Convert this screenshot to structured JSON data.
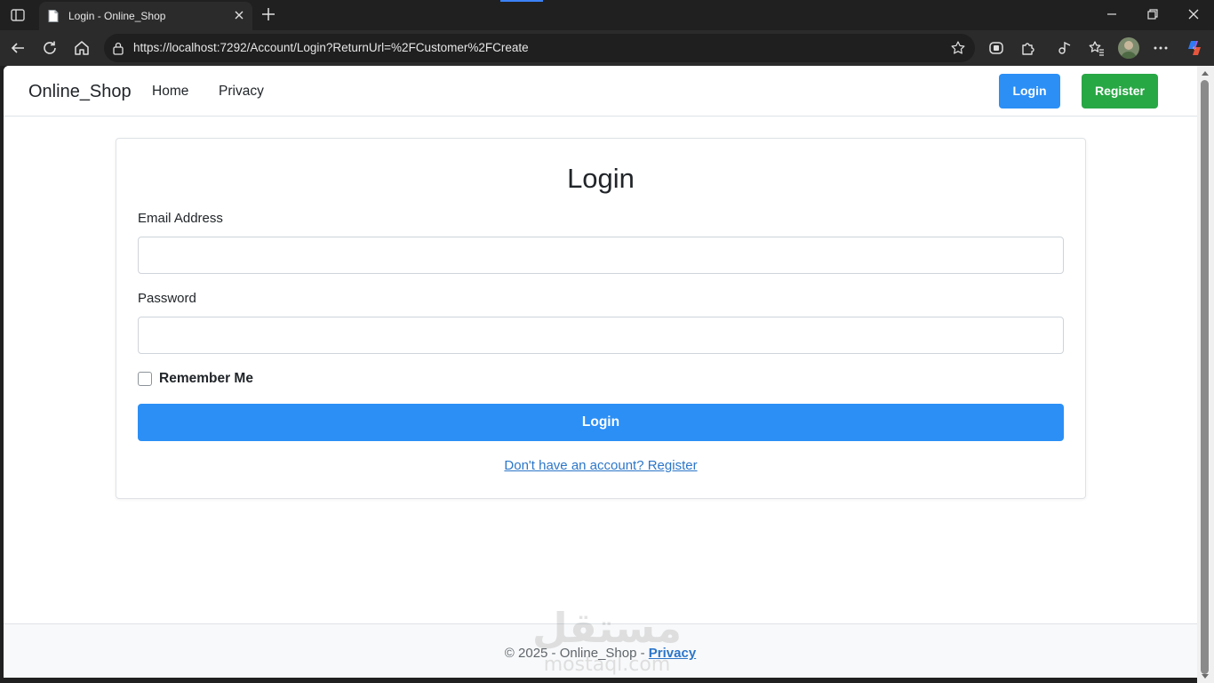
{
  "browser": {
    "tab_title": "Login - Online_Shop",
    "url": "https://localhost:7292/Account/Login?ReturnUrl=%2FCustomer%2FCreate",
    "accent_color": "#3b82f6",
    "icons": [
      "sidebar-toggle-icon",
      "page-favicon-icon",
      "close-tab-icon",
      "new-tab-icon",
      "minimize-icon",
      "maximize-icon",
      "close-window-icon",
      "back-icon",
      "reload-icon",
      "home-icon",
      "lock-icon",
      "favorite-star-icon",
      "extension-icon",
      "puzzle-icon",
      "split-screen-icon",
      "favorites-icon",
      "profile-avatar",
      "more-icon",
      "copilot-icon"
    ]
  },
  "navbar": {
    "brand": "Online_Shop",
    "links": [
      "Home",
      "Privacy"
    ],
    "login_label": "Login",
    "register_label": "Register",
    "login_color": "#2b8ff6",
    "register_color": "#28a745"
  },
  "login_form": {
    "title": "Login",
    "email_label": "Email Address",
    "email_value": "",
    "password_label": "Password",
    "password_value": "",
    "remember_label": "Remember Me",
    "remember_checked": false,
    "submit_label": "Login",
    "register_link": "Don't have an account? Register"
  },
  "footer": {
    "copyright": "© 2025 - Online_Shop -",
    "privacy_link": "Privacy"
  },
  "watermark": {
    "line1": "مستقل",
    "line2": "mostaql.com"
  }
}
